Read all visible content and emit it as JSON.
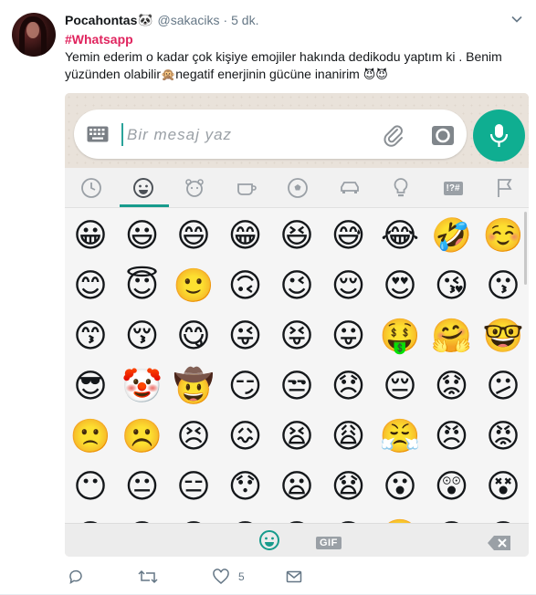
{
  "tweet": {
    "display_name": "Pocahontas",
    "name_emoji": "🐼",
    "handle": "@sakaciks",
    "separator": "·",
    "time": "5 dk.",
    "hashtag": "#Whatsapp",
    "text_part1": "Yemin ederim o kadar çok kişiye emojiler hakında dedikodu yaptım ki . Benim yüzünden olabilir",
    "emoji_monkey": "🙊",
    "text_part2": "negatif enerjinin gücüne inanirim",
    "emoji_devils": "😈😈",
    "like_count": "5"
  },
  "whatsapp": {
    "placeholder": "Bir mesaj yaz",
    "gif_label": "GIF",
    "categories": [
      "recent-icon",
      "smileys-icon",
      "animals-icon",
      "food-icon",
      "activity-icon",
      "travel-icon",
      "objects-icon",
      "symbols-icon",
      "flags-icon"
    ],
    "symbols_label": "!?#",
    "emoji_rows": [
      [
        "😀",
        "😃",
        "😄",
        "😁",
        "😆",
        "😅",
        "😂",
        "🤣",
        "☺️"
      ],
      [
        "😊",
        "😇",
        "🙂",
        "🙃",
        "😉",
        "😌",
        "😍",
        "😘",
        "😗"
      ],
      [
        "😙",
        "😚",
        "😋",
        "😜",
        "😝",
        "😛",
        "🤑",
        "🤗",
        "🤓"
      ],
      [
        "😎",
        "🤡",
        "🤠",
        "😏",
        "😒",
        "😞",
        "😔",
        "😟",
        "😕"
      ],
      [
        "🙁",
        "☹️",
        "😣",
        "😖",
        "😫",
        "😩",
        "😤",
        "😠",
        "😡"
      ],
      [
        "😶",
        "😐",
        "😑",
        "😯",
        "😦",
        "😧",
        "😮",
        "😲",
        "😵"
      ],
      [
        "😳",
        "😱",
        "😨",
        "😰",
        "😢",
        "😥",
        "🤤",
        "😭",
        "😓"
      ]
    ],
    "accent_color": "#0fae91"
  }
}
